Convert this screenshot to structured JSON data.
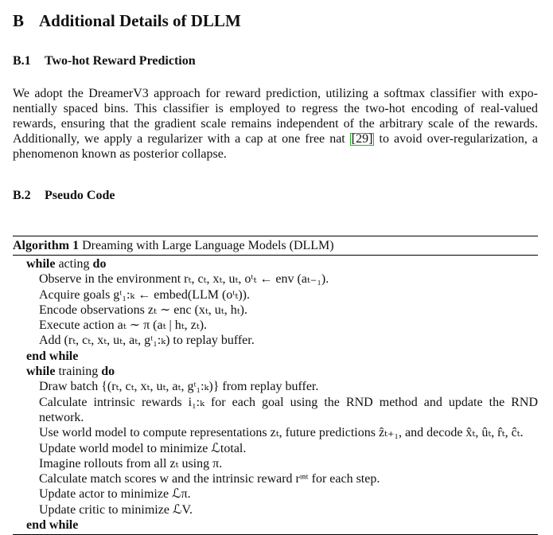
{
  "section": {
    "number": "B",
    "title": "Additional Details of DLLM"
  },
  "subsection1": {
    "number": "B.1",
    "title": "Two-hot Reward Prediction"
  },
  "paragraph": {
    "line1": "We adopt the DreamerV3 approach for reward prediction, utilizing a softmax classifier with expo-",
    "line2": "nentially spaced bins. This classifier is employed to regress the two-hot encoding of real-valued",
    "line3": "rewards, ensuring that the gradient scale remains independent of the arbitrary scale of the rewards.",
    "line4_pre": "Additionally, we apply a regularizer with a cap at one free nat",
    "citation": "[29]",
    "line4_post": "to avoid over-regularization, a",
    "line5": "phenomenon known as posterior collapse."
  },
  "subsection2": {
    "number": "B.2",
    "title": "Pseudo Code"
  },
  "algorithm": {
    "label": "Algorithm 1",
    "caption": "Dreaming with Large Language Models (DLLM)",
    "lines": {
      "while_acting_kw": "while",
      "while_acting_text": "acting",
      "do1": "do",
      "observe": "Observe in the environment rₜ, cₜ, xₜ, uₜ, oᵗₜ ← env (aₜ₋₁).",
      "acquire": "Acquire goals gᵗ₁:ₖ ← embed(LLM (oᵗₜ)).",
      "encode": "Encode observations zₜ ∼ enc (xₜ, uₜ, hₜ).",
      "execute": "Execute action aₜ ∼ π (aₜ | hₜ, zₜ).",
      "add": "Add (rₜ, cₜ, xₜ, uₜ, aₜ, gᵗ₁:ₖ) to replay buffer.",
      "end_while1": "end while",
      "while_training_kw": "while",
      "while_training_text": "training",
      "do2": "do",
      "draw": "Draw batch {(rₜ, cₜ, xₜ, uₜ, aₜ, gᵗ₁:ₖ)} from replay buffer.",
      "calc_intrinsic_1": "Calculate intrinsic rewards i₁:ₖ for each goal using the RND method and update the RND",
      "calc_intrinsic_2": "network.",
      "use_world": "Use world model to compute representations zₜ, future predictions ẑₜ₊₁, and decode x̂ₜ, ûₜ, r̂ₜ, ĉₜ.",
      "update_world": "Update world model to minimize ℒtotal.",
      "imagine": "Imagine rollouts from all zₜ using π.",
      "calc_match": "Calculate match scores w and the intrinsic reward rᶦⁿᵗ for each step.",
      "update_actor": "Update actor to minimize ℒπ.",
      "update_critic": "Update critic to minimize ℒV.",
      "end_while2": "end while"
    }
  }
}
